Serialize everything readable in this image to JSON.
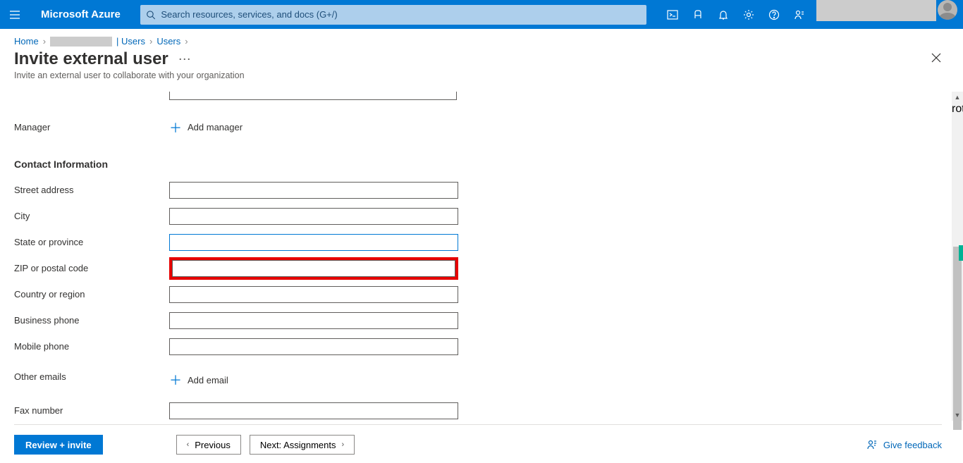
{
  "header": {
    "brand": "Microsoft Azure",
    "search_placeholder": "Search resources, services, and docs (G+/)"
  },
  "breadcrumb": {
    "home": "Home",
    "tenant_suffix": "| Users",
    "users": "Users"
  },
  "blade": {
    "title": "Invite external user",
    "subtitle": "Invite an external user to collaborate with your organization"
  },
  "form": {
    "manager_label": "Manager",
    "add_manager": "Add manager",
    "contact_section": "Contact Information",
    "street_label": "Street address",
    "city_label": "City",
    "state_label": "State or province",
    "zip_label": "ZIP or postal code",
    "country_label": "Country or region",
    "business_phone_label": "Business phone",
    "mobile_phone_label": "Mobile phone",
    "other_emails_label": "Other emails",
    "add_email": "Add email",
    "fax_label": "Fax number",
    "values": {
      "street": "",
      "city": "",
      "state": "",
      "zip": "",
      "country": "",
      "business_phone": "",
      "mobile_phone": "",
      "fax": ""
    }
  },
  "footer": {
    "review": "Review + invite",
    "previous": "Previous",
    "next": "Next: Assignments",
    "feedback": "Give feedback"
  }
}
